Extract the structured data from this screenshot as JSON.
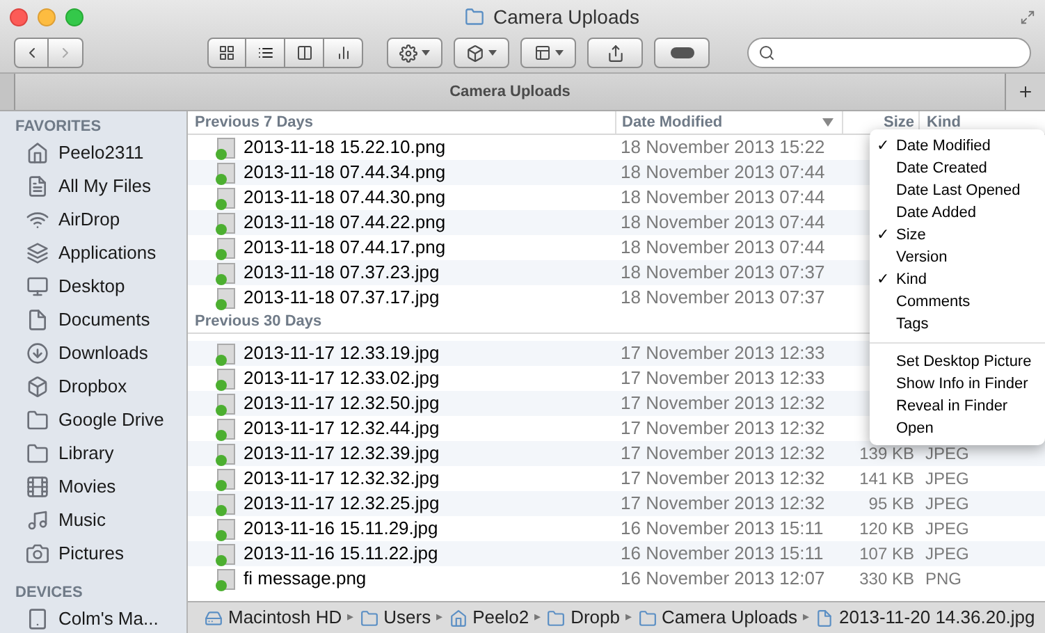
{
  "window": {
    "title": "Camera Uploads"
  },
  "tab": {
    "label": "Camera Uploads",
    "selected": true
  },
  "view_buttons": [
    {
      "kind": "icons",
      "selected": false
    },
    {
      "kind": "list",
      "selected": true
    },
    {
      "kind": "columns",
      "selected": false
    },
    {
      "kind": "coverflow",
      "selected": false
    }
  ],
  "sidebar": {
    "sections": [
      {
        "title": "FAVORITES",
        "items": [
          {
            "label": "Peelo2311"
          },
          {
            "label": "All My Files"
          },
          {
            "label": "AirDrop"
          },
          {
            "label": "Applications"
          },
          {
            "label": "Desktop"
          },
          {
            "label": "Documents"
          },
          {
            "label": "Downloads"
          },
          {
            "label": "Dropbox"
          },
          {
            "label": "Google Drive"
          },
          {
            "label": "Library"
          },
          {
            "label": "Movies"
          },
          {
            "label": "Music"
          },
          {
            "label": "Pictures"
          }
        ]
      },
      {
        "title": "DEVICES",
        "items": [
          {
            "label": "Colm's Ma..."
          }
        ]
      }
    ]
  },
  "table": {
    "columns": [
      "Date Modified",
      "Size",
      "Kind"
    ],
    "groups": [
      {
        "title": "Previous 7 Days",
        "rows": [
          {
            "name": "2013-11-18 15.22.10.png",
            "date": "18 November 2013 15:22"
          },
          {
            "name": "2013-11-18 07.44.34.png",
            "date": "18 November 2013 07:44"
          },
          {
            "name": "2013-11-18 07.44.30.png",
            "date": "18 November 2013 07:44"
          },
          {
            "name": "2013-11-18 07.44.22.png",
            "date": "18 November 2013 07:44"
          },
          {
            "name": "2013-11-18 07.44.17.png",
            "date": "18 November 2013 07:44"
          },
          {
            "name": "2013-11-18 07.37.23.jpg",
            "date": "18 November 2013 07:37"
          },
          {
            "name": "2013-11-18 07.37.17.jpg",
            "date": "18 November 2013 07:37"
          }
        ]
      },
      {
        "title": "Previous 30 Days",
        "rows": [
          {
            "name": "2013-11-17 12.33.19.jpg",
            "date": "17 November 2013 12:33"
          },
          {
            "name": "2013-11-17 12.33.02.jpg",
            "date": "17 November 2013 12:33"
          },
          {
            "name": "2013-11-17 12.32.50.jpg",
            "date": "17 November 2013 12:32"
          },
          {
            "name": "2013-11-17 12.32.44.jpg",
            "date": "17 November 2013 12:32"
          },
          {
            "name": "2013-11-17 12.32.39.jpg",
            "date": "17 November 2013 12:32",
            "size": "139 KB",
            "kind": "JPEG"
          },
          {
            "name": "2013-11-17 12.32.32.jpg",
            "date": "17 November 2013 12:32",
            "size": "141 KB",
            "kind": "JPEG"
          },
          {
            "name": "2013-11-17 12.32.25.jpg",
            "date": "17 November 2013 12:32",
            "size": "95 KB",
            "kind": "JPEG"
          },
          {
            "name": "2013-11-16 15.11.29.jpg",
            "date": "16 November 2013 15:11",
            "size": "120 KB",
            "kind": "JPEG"
          },
          {
            "name": "2013-11-16 15.11.22.jpg",
            "date": "16 November 2013 15:11",
            "size": "107 KB",
            "kind": "JPEG"
          },
          {
            "name": "fi message.png",
            "date": "16 November 2013 12:07",
            "size": "330 KB",
            "kind": "PNG"
          }
        ]
      }
    ]
  },
  "context_menu": {
    "sections": [
      [
        {
          "label": "Date Modified",
          "checked": true
        },
        {
          "label": "Date Created",
          "checked": false
        },
        {
          "label": "Date Last Opened",
          "checked": false
        },
        {
          "label": "Date Added",
          "checked": false
        },
        {
          "label": "Size",
          "checked": true
        },
        {
          "label": "Version",
          "checked": false
        },
        {
          "label": "Kind",
          "checked": true
        },
        {
          "label": "Comments",
          "checked": false
        },
        {
          "label": "Tags",
          "checked": false
        }
      ],
      [
        {
          "label": "Set Desktop Picture",
          "checked": false
        },
        {
          "label": "Show Info in Finder",
          "checked": false
        },
        {
          "label": "Reveal in Finder",
          "checked": false
        },
        {
          "label": "Open",
          "checked": false
        }
      ]
    ],
    "check": "✓"
  },
  "path_bar": [
    {
      "label": "Macintosh HD"
    },
    {
      "label": "Users"
    },
    {
      "label": "Peelo2"
    },
    {
      "label": "Dropb"
    },
    {
      "label": "Camera Uploads"
    },
    {
      "label": "2013-11-20 14.36.20.jpg"
    }
  ],
  "path_separator": "▸"
}
